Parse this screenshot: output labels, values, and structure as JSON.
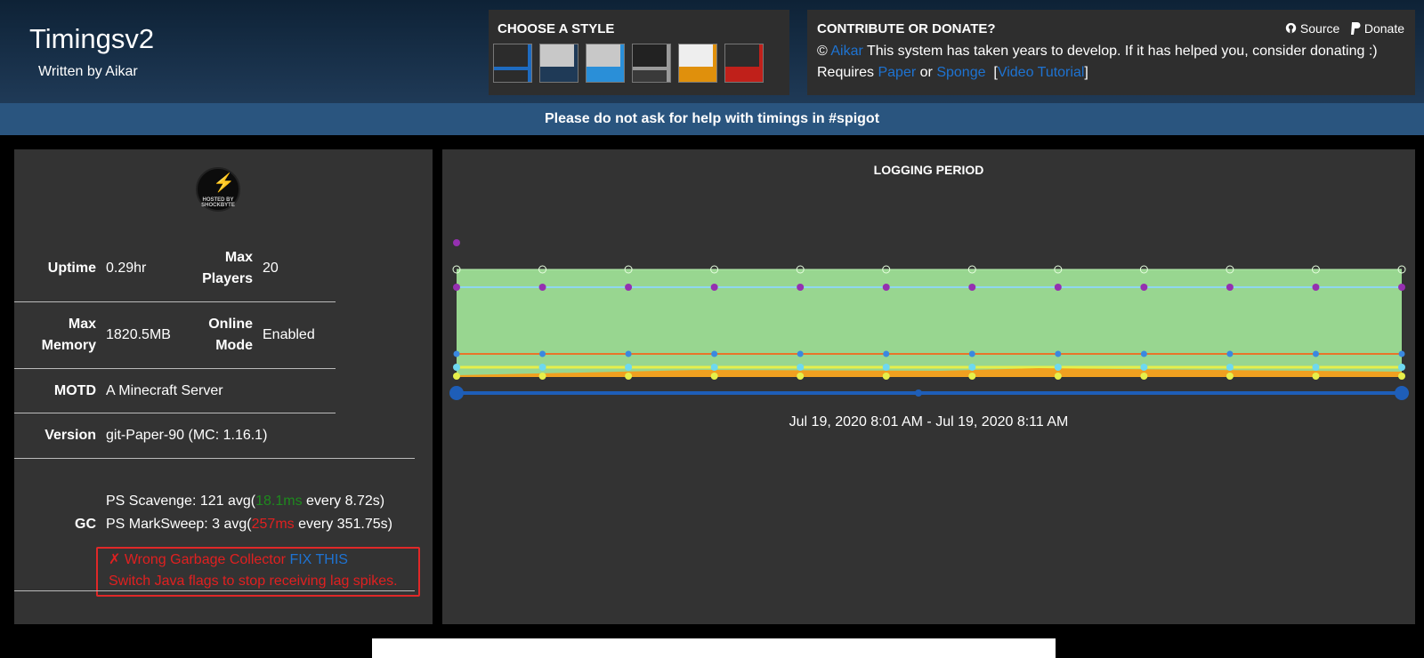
{
  "header": {
    "title": "Timingsv2",
    "subtitle": "Written by Aikar"
  },
  "styles": {
    "title": "CHOOSE A STYLE",
    "swatches": [
      {
        "name": "dark-blue",
        "top": "#2c2c2c",
        "bottom": "#2c2c2c",
        "accent": "#1e6bc0"
      },
      {
        "name": "light-navy",
        "top": "#c8c8c8",
        "bottom": "#1f3a57",
        "accent": "#1f3a57"
      },
      {
        "name": "light-blue",
        "top": "#c8c8c8",
        "bottom": "#2a8fd8",
        "accent": "#2a8fd8"
      },
      {
        "name": "dark-gray",
        "top": "#222222",
        "bottom": "#3a3a3a",
        "accent": "#9a9a9a"
      },
      {
        "name": "orange",
        "top": "#eeeeee",
        "bottom": "#e0900c",
        "accent": "#e0900c"
      },
      {
        "name": "dark-red",
        "top": "#2c2c2c",
        "bottom": "#c0201a",
        "accent": "#c0201a"
      }
    ]
  },
  "contribute": {
    "title": "CONTRIBUTE OR DONATE?",
    "source_label": "Source",
    "donate_label": "Donate",
    "copyright_symbol": "©",
    "author_link": "Aikar",
    "message": "This system has taken years to develop. If it has helped you, consider donating :)",
    "requires_label": "Requires",
    "paper_link": "Paper",
    "or_text": "or",
    "sponge_link": "Sponge",
    "video_open": "[",
    "video_link": "Video Tutorial",
    "video_close": "]"
  },
  "notice": "Please do not ask for help with timings in #spigot",
  "server_info": {
    "logo_text": "HOSTED BY SHOCKBYTE",
    "uptime_label": "Uptime",
    "uptime_value": "0.29hr",
    "max_players_label_1": "Max",
    "max_players_label_2": "Players",
    "max_players_value": "20",
    "max_memory_label_1": "Max",
    "max_memory_label_2": "Memory",
    "max_memory_value": "1820.5MB",
    "online_mode_label_1": "Online",
    "online_mode_label_2": "Mode",
    "online_mode_value": "Enabled",
    "motd_label": "MOTD",
    "motd_value": "A Minecraft Server",
    "version_label": "Version",
    "version_value": "git-Paper-90 (MC: 1.16.1)",
    "gc_label": "GC",
    "gc_scavenge_prefix": "PS Scavenge: 121 avg(",
    "gc_scavenge_ms": "18.1ms",
    "gc_scavenge_suffix": " every 8.72s)",
    "gc_marksweep_prefix": "PS MarkSweep: 3 avg(",
    "gc_marksweep_ms": "257ms",
    "gc_marksweep_suffix": " every 351.75s)",
    "gc_warning": "✗ Wrong Garbage Collector",
    "gc_fix_link": "FIX THIS",
    "gc_warning_2": "Switch Java flags to stop receiving lag spikes."
  },
  "chart": {
    "title": "LOGGING PERIOD",
    "range_text": "Jul 19, 2020 8:01 AM - Jul 19, 2020 8:11 AM",
    "colors": {
      "area": "#98d690",
      "purple": "#9530b0",
      "light_blue_line": "#8fd6f0",
      "orange_line": "#e8742a",
      "blue_points": "#3a88e0",
      "cyan_points": "#6ed8f0",
      "yellow": "#e6ef4a",
      "slider": "#1e5eb8"
    }
  }
}
